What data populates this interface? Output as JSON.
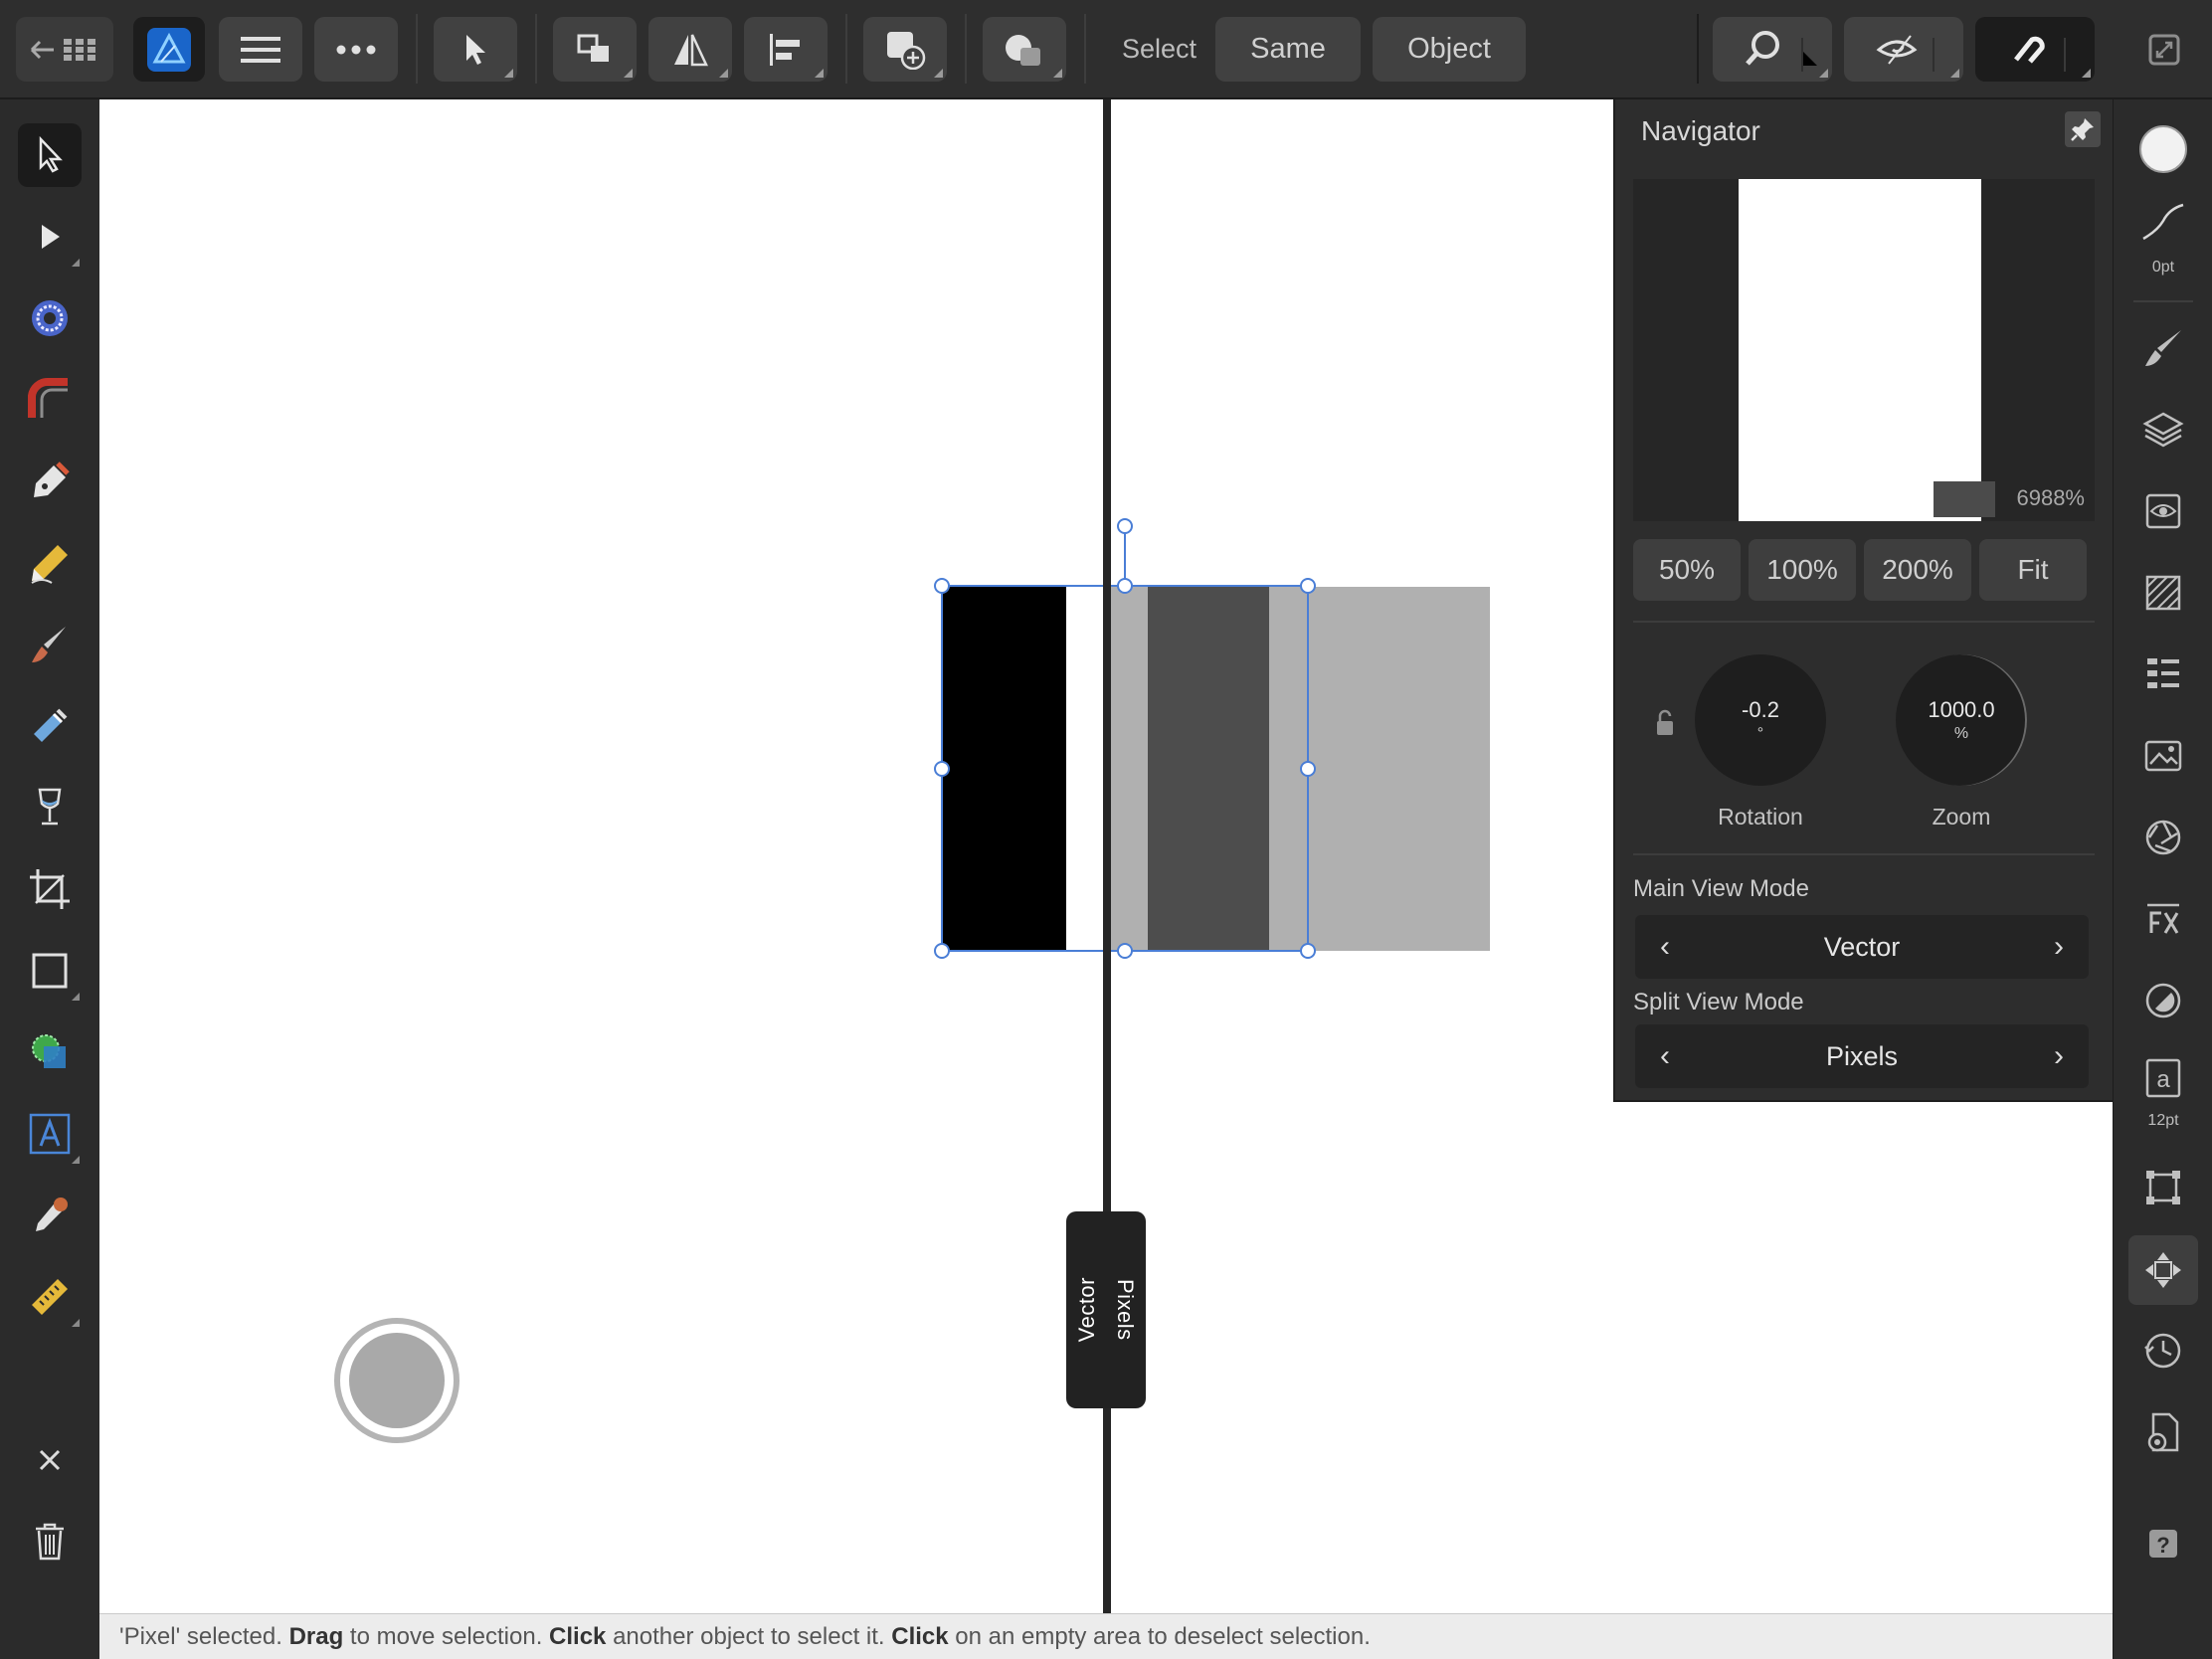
{
  "toolbar": {
    "select_label": "Select",
    "same_label": "Same",
    "object_label": "Object"
  },
  "navigator": {
    "title": "Navigator",
    "preview_zoom": "6988%",
    "zoom_presets": [
      "50%",
      "100%",
      "200%",
      "Fit"
    ],
    "rotation": {
      "value": "-0.2",
      "unit": "°",
      "label": "Rotation"
    },
    "zoom": {
      "value": "1000.0",
      "unit": "%",
      "label": "Zoom"
    },
    "main_view_mode": {
      "label": "Main View Mode",
      "value": "Vector"
    },
    "split_view_mode": {
      "label": "Split View Mode",
      "value": "Pixels"
    }
  },
  "split_view": {
    "left_label": "Vector",
    "right_label": "Pixels"
  },
  "studio": {
    "stroke_width": "0pt",
    "text_size": "12pt"
  },
  "status": {
    "p1": "'Pixel' selected. ",
    "b1": "Drag",
    "p2": " to move selection. ",
    "b2": "Click",
    "p3": " another object to select it. ",
    "b3": "Click",
    "p4": " on an empty area to deselect selection."
  },
  "canvas_colors": {
    "black": "#000000",
    "dark_gray": "#4d4d4d",
    "light_gray": "#b0b0b0",
    "selection": "#4a7ed6"
  }
}
